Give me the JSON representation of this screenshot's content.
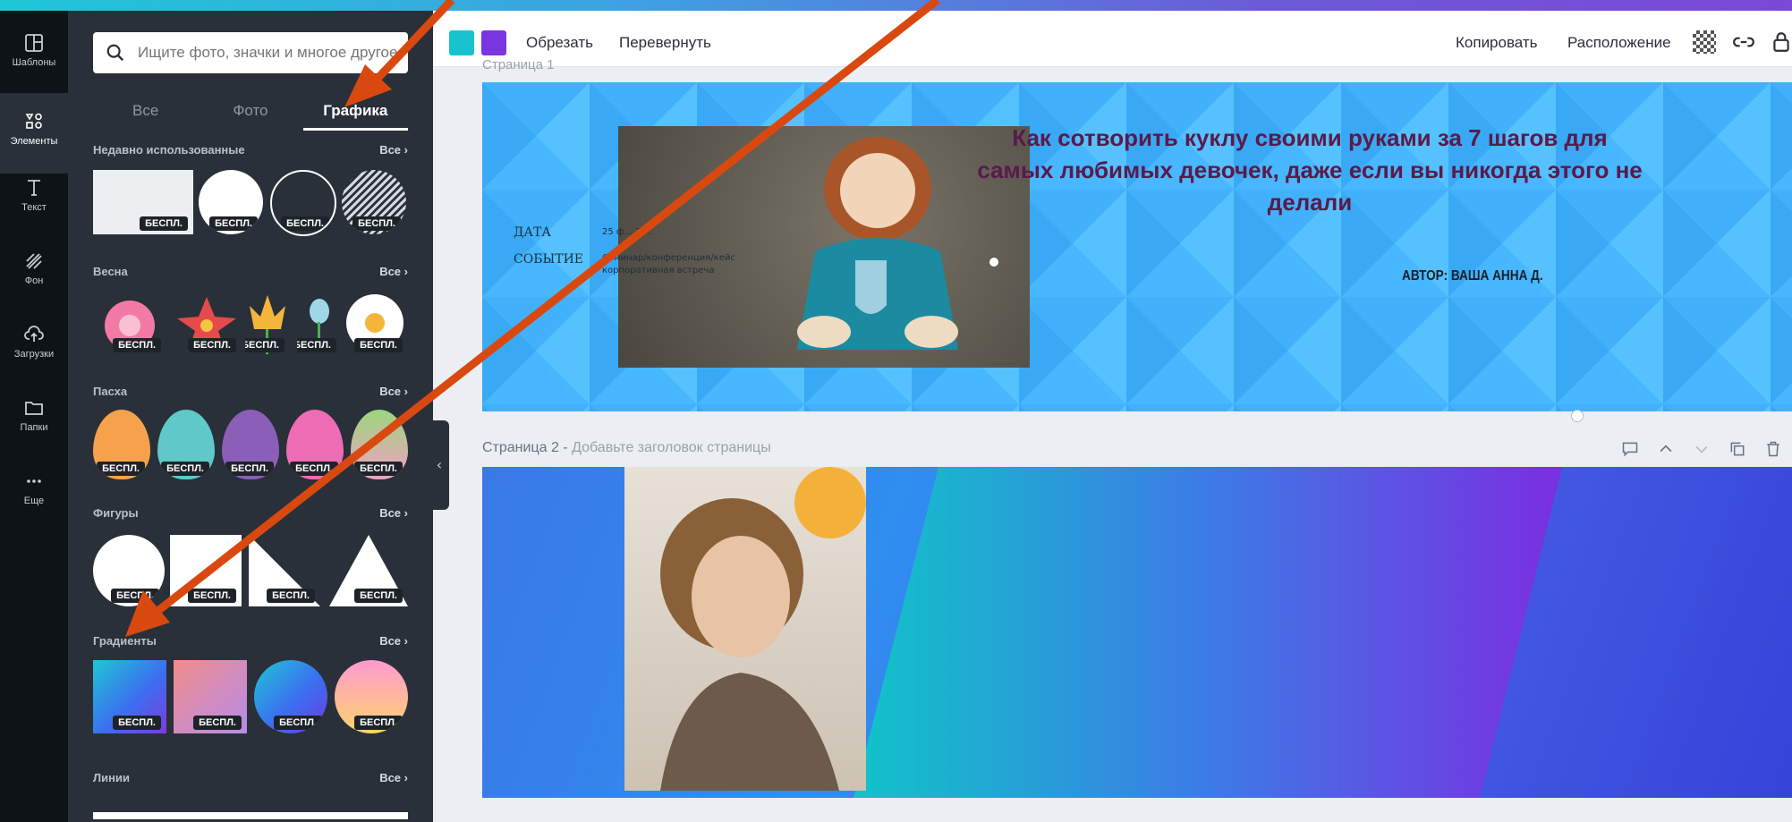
{
  "rail": {
    "items": [
      {
        "label": "Шаблоны",
        "icon": "layout-icon"
      },
      {
        "label": "Элементы",
        "icon": "shapes-icon"
      },
      {
        "label": "Текст",
        "icon": "text-icon"
      },
      {
        "label": "Фон",
        "icon": "background-icon"
      },
      {
        "label": "Загрузки",
        "icon": "upload-icon"
      },
      {
        "label": "Папки",
        "icon": "folder-icon"
      },
      {
        "label": "Еще",
        "icon": "more-icon"
      }
    ]
  },
  "panel": {
    "search_placeholder": "Ищите фото, значки и многое другое",
    "tabs": [
      {
        "label": "Все"
      },
      {
        "label": "Фото"
      },
      {
        "label": "Графика"
      }
    ],
    "sections": [
      {
        "title": "Недавно использованные",
        "all": "Все"
      },
      {
        "title": "Весна",
        "all": "Все"
      },
      {
        "title": "Пасха",
        "all": "Все"
      },
      {
        "title": "Фигуры",
        "all": "Все"
      },
      {
        "title": "Градиенты",
        "all": "Все"
      },
      {
        "title": "Линии",
        "all": "Все"
      }
    ],
    "badge": "БЕСПЛ."
  },
  "toolbar": {
    "swatch1": "#19c2cf",
    "swatch2": "#7b35e0",
    "crop": "Обрезать",
    "flip": "Перевернуть",
    "copy": "Копировать",
    "arrange": "Расположение"
  },
  "page1": {
    "top_label": "Страница 1",
    "title": "Как сотворить куклу своими руками за 7 шагов для самых любимых девочек, даже если вы никогда этого не делали",
    "author": "АВТОР: ВАША АННА Д.",
    "date_label": "ДАТА",
    "event_label": "СОБЫТИЕ",
    "date_value": "25 ф... 20..",
    "event_value": "Семинар/конференция/кейс корпоративная встреча"
  },
  "page2": {
    "label": "Страница 2 -",
    "hint": "Добавьте заголовок страницы"
  },
  "colors": {
    "arrow": "#d9490f",
    "title_text": "#5a1a4a"
  }
}
